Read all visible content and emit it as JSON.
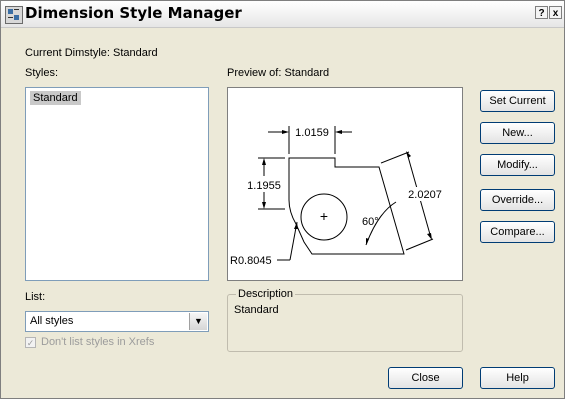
{
  "window": {
    "title": "Dimension Style Manager",
    "help_glyph": "?",
    "close_glyph": "x"
  },
  "current_dimstyle": "Current Dimstyle: Standard",
  "styles_label": "Styles:",
  "styles_list": {
    "items": [
      "Standard"
    ],
    "selected": "Standard"
  },
  "preview_label": "Preview of: Standard",
  "preview": {
    "dim_horizontal": "1.0159",
    "dim_vertical": "1.1955",
    "dim_aligned": "2.0207",
    "dim_radius": "R0.8045",
    "dim_angle": "60°",
    "center_mark": "+"
  },
  "buttons": {
    "set_current": "Set Current",
    "new": "New...",
    "modify": "Modify...",
    "override": "Override...",
    "compare": "Compare...",
    "close": "Close",
    "help": "Help"
  },
  "list_label": "List:",
  "list_select": {
    "value": "All styles"
  },
  "xrefs_checkbox": {
    "label": "Don't list styles in Xrefs",
    "checked": true,
    "enabled": false
  },
  "description": {
    "legend": "Description",
    "text": "Standard"
  }
}
